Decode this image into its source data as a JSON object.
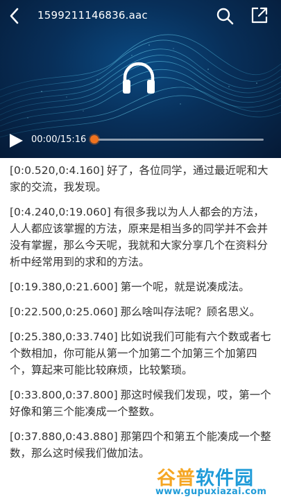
{
  "header": {
    "file_name": "1599211146836.aac",
    "back_icon": "chevron-left-icon",
    "search_icon": "search-icon",
    "share_icon": "share-icon"
  },
  "player": {
    "state_icon": "play-icon",
    "center_icon": "headphones-icon",
    "time_display": "00:00/15:16",
    "progress_fraction": 0.0,
    "accent_color": "#f0731f",
    "background_color": "#082f59"
  },
  "transcript": [
    {
      "timestamp": "[0:0.520,0:4.160]",
      "text": "好了，各位同学，通过最近呢和大家的交流，我发现。"
    },
    {
      "timestamp": "[0:4.240,0:19.060]",
      "text": "有很多我以为人人都会的方法，人人都应该掌握的方法，原来是相当多的同学并不会并没有掌握，那么今天呢，我就和大家分享几个在资料分析中经常用到的求和的方法。"
    },
    {
      "timestamp": "[0:19.380,0:21.600]",
      "text": "第一个呢，就是说凑成法。"
    },
    {
      "timestamp": "[0:22.500,0:25.060]",
      "text": "那么啥叫存法呢？顾名思义。"
    },
    {
      "timestamp": "[0:25.380,0:33.740]",
      "text": "比如说我们可能有六个数或者七个数相加，你可能从第一个加第二个加第三个加第四个，算起来可能比较麻烦，比较繁琐。"
    },
    {
      "timestamp": "[0:33.800,0:37.800]",
      "text": "那这时候我们发现，哎，第一个好像和第三个能凑成一个整数。"
    },
    {
      "timestamp": "[0:37.880,0:43.880]",
      "text": "那第四个和第五个能凑成一个整数，那么这时候我们做加法。"
    }
  ],
  "watermark": {
    "logo_part1": "谷普",
    "logo_part2": "软件园",
    "url": "www.gupuxiazai.com"
  }
}
